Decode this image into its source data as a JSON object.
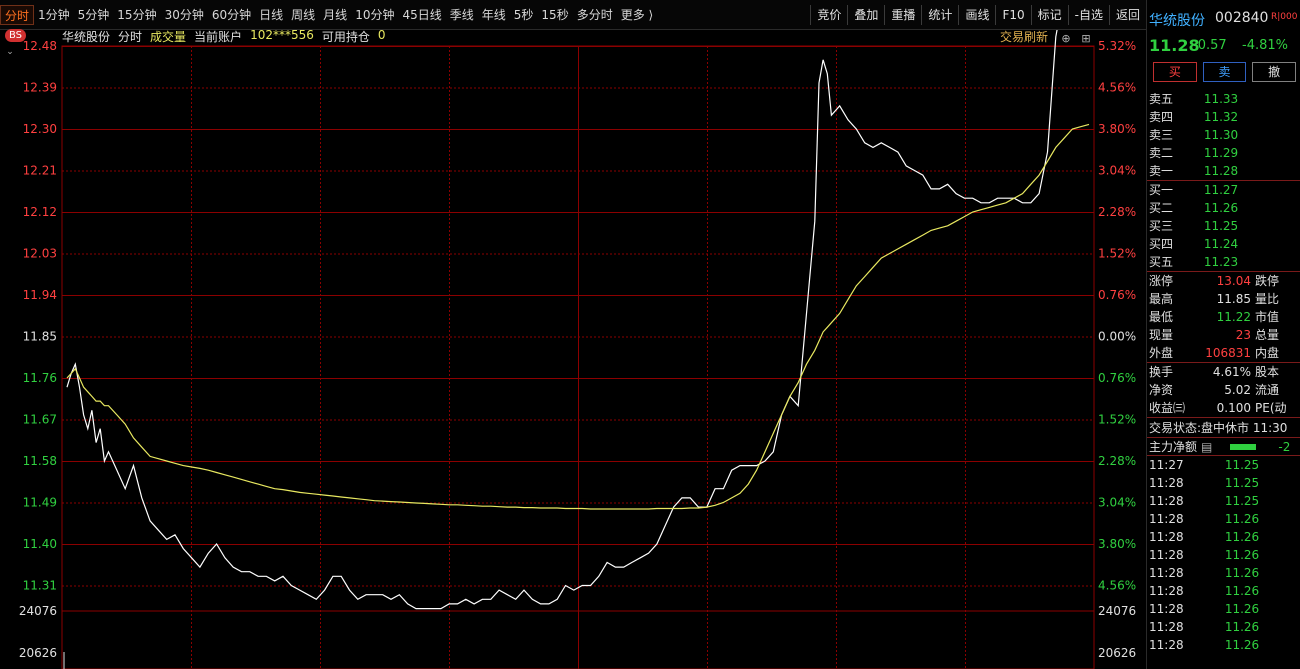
{
  "toolbar": {
    "periods": [
      "分时",
      "1分钟",
      "5分钟",
      "15分钟",
      "30分钟",
      "60分钟",
      "日线",
      "周线",
      "月线",
      "10分钟",
      "45日线",
      "季线",
      "年线",
      "5秒",
      "15秒",
      "多分时",
      "更多 ⟩"
    ],
    "active_period": "分时",
    "tools": [
      "竞价",
      "叠加",
      "重播",
      "统计",
      "画线",
      "F10",
      "标记",
      "-自选",
      "返回"
    ]
  },
  "chart": {
    "badge": "BS",
    "stock_name": "华统股份",
    "mode": "分时",
    "indicator": "成交量",
    "account_label": "当前账户",
    "account_id": "102***556",
    "position_label": "可用持仓",
    "position_value": "0",
    "refresh_label": "交易刷新",
    "left_ticks": [
      "12.48",
      "12.39",
      "12.30",
      "12.21",
      "12.12",
      "12.03",
      "11.94",
      "11.85",
      "11.76",
      "11.67",
      "11.58",
      "11.49",
      "11.40",
      "11.31"
    ],
    "right_ticks": [
      "5.32%",
      "4.56%",
      "3.80%",
      "3.04%",
      "2.28%",
      "1.52%",
      "0.76%",
      "0.00%",
      "0.76%",
      "1.52%",
      "2.28%",
      "3.04%",
      "3.80%",
      "4.56%"
    ],
    "volume_left": [
      "24076",
      "20626"
    ],
    "volume_right": [
      "24076",
      "20626"
    ],
    "colors": {
      "up": "#ff4040",
      "down": "#30d040",
      "flat": "#e0e0e0",
      "grid": "#8b0000",
      "price_line": "#ffffff",
      "avg_line": "#e8e860"
    }
  },
  "chart_data": {
    "type": "line",
    "title": "华统股份 分时",
    "xlabel": "",
    "ylabel": "",
    "ylim": [
      11.22,
      12.48
    ],
    "prev_close": 11.85,
    "x": [
      0,
      1,
      2,
      3,
      4,
      5,
      6,
      7,
      8,
      9,
      10,
      12,
      14,
      16,
      18,
      20,
      22,
      24,
      26,
      28,
      30,
      32,
      34,
      36,
      38,
      40,
      42,
      44,
      46,
      48,
      50,
      52,
      54,
      56,
      58,
      60,
      62,
      64,
      66,
      68,
      70,
      72,
      74,
      76,
      78,
      80,
      82,
      84,
      86,
      88,
      90,
      92,
      94,
      96,
      98,
      100,
      102,
      104,
      106,
      108,
      110,
      112,
      114,
      116,
      118,
      120,
      122,
      124,
      126,
      128,
      130,
      132,
      134,
      136,
      138,
      140,
      142,
      144,
      146,
      148,
      150,
      152,
      154,
      156,
      158,
      160,
      162,
      164,
      166,
      168,
      170,
      172,
      174,
      176,
      178,
      180,
      181,
      182,
      183,
      184,
      186,
      188,
      190,
      192,
      194,
      196,
      198,
      200,
      202,
      204,
      206,
      208,
      210,
      212,
      214,
      216,
      218,
      220,
      222,
      224,
      226,
      228,
      230,
      232,
      234,
      236,
      238,
      240,
      242,
      244,
      246
    ],
    "series": [
      {
        "name": "价格",
        "values": [
          11.74,
          11.77,
          11.79,
          11.74,
          11.68,
          11.65,
          11.69,
          11.62,
          11.65,
          11.58,
          11.6,
          11.56,
          11.52,
          11.57,
          11.5,
          11.45,
          11.43,
          11.41,
          11.42,
          11.39,
          11.37,
          11.35,
          11.38,
          11.4,
          11.37,
          11.35,
          11.34,
          11.34,
          11.33,
          11.33,
          11.32,
          11.33,
          11.31,
          11.3,
          11.29,
          11.28,
          11.3,
          11.33,
          11.33,
          11.3,
          11.28,
          11.29,
          11.29,
          11.29,
          11.28,
          11.29,
          11.27,
          11.26,
          11.26,
          11.26,
          11.26,
          11.27,
          11.27,
          11.28,
          11.27,
          11.28,
          11.28,
          11.3,
          11.29,
          11.28,
          11.3,
          11.28,
          11.27,
          11.27,
          11.28,
          11.31,
          11.3,
          11.31,
          11.31,
          11.33,
          11.36,
          11.35,
          11.35,
          11.36,
          11.37,
          11.38,
          11.4,
          11.44,
          11.48,
          11.5,
          11.5,
          11.48,
          11.48,
          11.52,
          11.52,
          11.56,
          11.57,
          11.57,
          11.57,
          11.58,
          11.6,
          11.68,
          11.72,
          11.7,
          11.9,
          12.1,
          12.4,
          12.45,
          12.42,
          12.33,
          12.35,
          12.32,
          12.3,
          12.27,
          12.26,
          12.27,
          12.26,
          12.25,
          12.22,
          12.21,
          12.2,
          12.17,
          12.17,
          12.18,
          12.16,
          12.15,
          12.15,
          12.14,
          12.14,
          12.15,
          12.15,
          12.15,
          12.14,
          12.14,
          12.16,
          12.25,
          12.5,
          12.6,
          12.6,
          12.6,
          12.6
        ]
      },
      {
        "name": "均价",
        "values": [
          11.76,
          11.77,
          11.78,
          11.76,
          11.74,
          11.73,
          11.72,
          11.71,
          11.71,
          11.7,
          11.7,
          11.68,
          11.66,
          11.63,
          11.61,
          11.59,
          11.585,
          11.58,
          11.575,
          11.57,
          11.567,
          11.564,
          11.56,
          11.555,
          11.55,
          11.545,
          11.54,
          11.535,
          11.53,
          11.525,
          11.52,
          11.518,
          11.515,
          11.512,
          11.51,
          11.508,
          11.506,
          11.504,
          11.502,
          11.5,
          11.498,
          11.496,
          11.494,
          11.493,
          11.492,
          11.491,
          11.49,
          11.489,
          11.488,
          11.487,
          11.486,
          11.485,
          11.485,
          11.484,
          11.483,
          11.482,
          11.482,
          11.481,
          11.48,
          11.48,
          11.479,
          11.479,
          11.478,
          11.478,
          11.478,
          11.477,
          11.477,
          11.477,
          11.476,
          11.476,
          11.476,
          11.476,
          11.476,
          11.476,
          11.476,
          11.476,
          11.477,
          11.477,
          11.477,
          11.477,
          11.478,
          11.478,
          11.48,
          11.484,
          11.49,
          11.5,
          11.51,
          11.53,
          11.56,
          11.6,
          11.64,
          11.68,
          11.72,
          11.75,
          11.79,
          11.82,
          11.84,
          11.86,
          11.87,
          11.88,
          11.9,
          11.93,
          11.96,
          11.98,
          12.0,
          12.02,
          12.03,
          12.04,
          12.05,
          12.06,
          12.07,
          12.08,
          12.085,
          12.09,
          12.1,
          12.11,
          12.12,
          12.125,
          12.13,
          12.135,
          12.14,
          12.15,
          12.16,
          12.18,
          12.2,
          12.23,
          12.26,
          12.28,
          12.3,
          12.305,
          12.31
        ]
      }
    ]
  },
  "quote": {
    "name": "华统股份",
    "code": "002840",
    "tag": "R|000",
    "price": "11.28",
    "change": "-0.57",
    "change_pct": "-4.81%",
    "buy_btn": "买",
    "sell_btn": "卖",
    "cancel_btn": "撤",
    "asks": [
      {
        "label": "卖五",
        "price": "11.33"
      },
      {
        "label": "卖四",
        "price": "11.32"
      },
      {
        "label": "卖三",
        "price": "11.30"
      },
      {
        "label": "卖二",
        "price": "11.29"
      },
      {
        "label": "卖一",
        "price": "11.28"
      }
    ],
    "bids": [
      {
        "label": "买一",
        "price": "11.27"
      },
      {
        "label": "买二",
        "price": "11.26"
      },
      {
        "label": "买三",
        "price": "11.25"
      },
      {
        "label": "买四",
        "price": "11.24"
      },
      {
        "label": "买五",
        "price": "11.23"
      }
    ],
    "stats": [
      {
        "label": "涨停",
        "value": "13.04",
        "label2": "跌停",
        "color": "r"
      },
      {
        "label": "最高",
        "value": "11.85",
        "label2": "量比",
        "color": "w"
      },
      {
        "label": "最低",
        "value": "11.22",
        "label2": "市值",
        "color": "g"
      },
      {
        "label": "现量",
        "value": "23",
        "label2": "总量",
        "color": "r"
      },
      {
        "label": "外盘",
        "value": "106831",
        "label2": "内盘",
        "color": "r"
      }
    ],
    "stats2": [
      {
        "label": "换手",
        "value": "4.61%",
        "label2": "股本"
      },
      {
        "label": "净资",
        "value": "5.02",
        "label2": "流通"
      },
      {
        "label": "收益㈢",
        "value": "0.100",
        "label2": "PE(动"
      }
    ],
    "status_label": "交易状态:",
    "status_value": "盘中休市 11:30",
    "net_label": "主力净额",
    "net_value": "-2",
    "ticks": [
      {
        "time": "11:27",
        "price": "11.25"
      },
      {
        "time": "11:28",
        "price": "11.25"
      },
      {
        "time": "11:28",
        "price": "11.25"
      },
      {
        "time": "11:28",
        "price": "11.26"
      },
      {
        "time": "11:28",
        "price": "11.26"
      },
      {
        "time": "11:28",
        "price": "11.26"
      },
      {
        "time": "11:28",
        "price": "11.26"
      },
      {
        "time": "11:28",
        "price": "11.26"
      },
      {
        "time": "11:28",
        "price": "11.26"
      },
      {
        "time": "11:28",
        "price": "11.26"
      },
      {
        "time": "11:28",
        "price": "11.26"
      }
    ]
  }
}
